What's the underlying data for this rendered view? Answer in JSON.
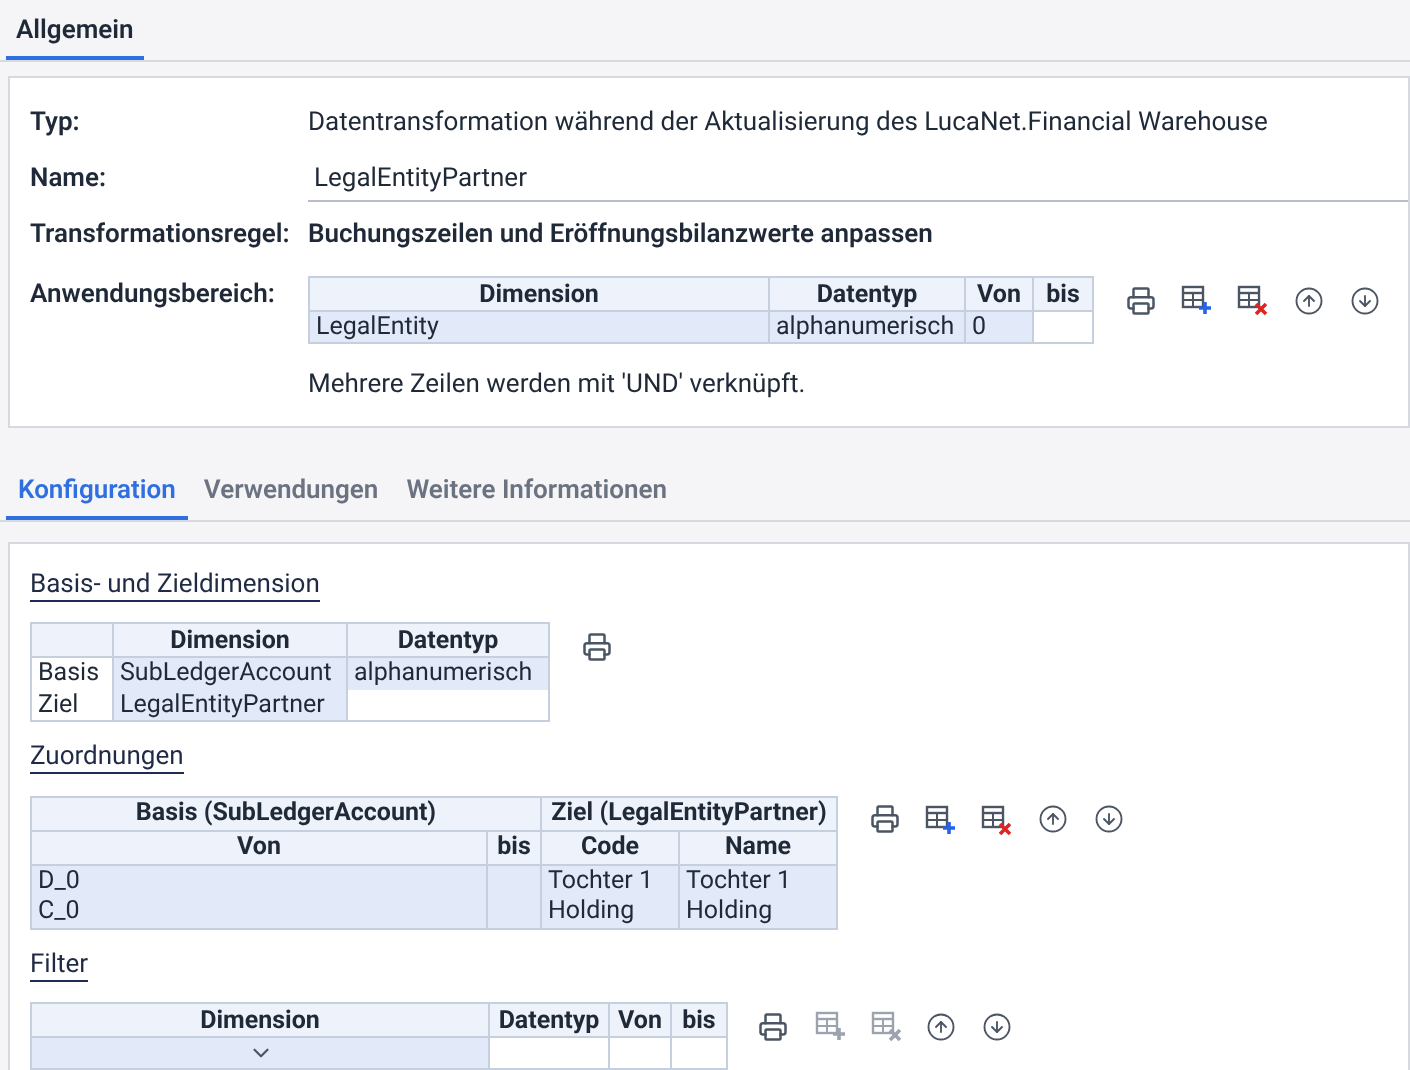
{
  "top_tabs": [
    {
      "label": "Allgemein",
      "selected": true
    }
  ],
  "general": {
    "fields": [
      {
        "kind": "text",
        "label": "Typ:",
        "value": "Datentransformation während der Aktualisierung des LucaNet.Financial Warehouse"
      },
      {
        "kind": "input",
        "label": "Name:",
        "value": "LegalEntityPartner"
      },
      {
        "kind": "bold",
        "label": "Transformationsregel:",
        "value": "Buchungszeilen und Eröffnungsbilanzwerte anpassen"
      }
    ],
    "scope": {
      "label": "Anwendungsbereich:",
      "table": {
        "groups": [
          {
            "columns": [
              "Dimension",
              "Datentyp",
              "Von",
              "bis"
            ]
          }
        ],
        "rows": [
          [
            {
              "text": "LegalEntity",
              "editable": true
            },
            {
              "text": "alphanumerisch",
              "editable": true
            },
            {
              "text": "0",
              "editable": true
            },
            {
              "editable": false
            }
          ]
        ]
      },
      "toolbar": [
        {
          "kind": "print",
          "disabled": false
        },
        {
          "kind": "add_row",
          "disabled": false
        },
        {
          "kind": "delete_row",
          "disabled": false
        },
        {
          "kind": "move_up",
          "disabled": false
        },
        {
          "kind": "move_down",
          "disabled": false
        }
      ],
      "note": "Mehrere Zeilen werden mit 'UND' verknüpft."
    }
  },
  "tabs": [
    {
      "label": "Konfiguration",
      "selected": true
    },
    {
      "label": "Verwendungen",
      "selected": false
    },
    {
      "label": "Weitere Informationen",
      "selected": false
    }
  ],
  "sections": [
    {
      "title": "Basis- und Zieldimension",
      "table": {
        "groups": [
          {
            "columns": [
              "",
              "Dimension",
              "Datentyp"
            ]
          }
        ],
        "rows": [
          [
            {
              "text": "Basis",
              "editable": false
            },
            {
              "text": "SubLedgerAccount",
              "editable": true
            },
            {
              "text": "alphanumerisch",
              "editable": true
            }
          ],
          [
            {
              "text": "Ziel",
              "editable": false
            },
            {
              "text": "LegalEntityPartner",
              "editable": true
            },
            {
              "editable": false
            }
          ]
        ]
      },
      "toolbar": [
        {
          "kind": "print",
          "disabled": false
        }
      ]
    },
    {
      "title": "Zuordnungen",
      "table": {
        "groups": [
          {
            "label": "Basis (SubLedgerAccount)",
            "columns": [
              "Von",
              "bis"
            ]
          },
          {
            "label": "Ziel (LegalEntityPartner)",
            "columns": [
              "Code",
              "Name"
            ]
          }
        ],
        "rows": [
          [
            {
              "text": "D_0",
              "editable": true
            },
            {
              "editable": true
            },
            {
              "text": "Tochter 1",
              "editable": true
            },
            {
              "text": "Tochter 1",
              "editable": true
            }
          ],
          [
            {
              "text": "C_0",
              "editable": true
            },
            {
              "editable": true
            },
            {
              "text": "Holding",
              "editable": true
            },
            {
              "text": "Holding",
              "editable": true
            }
          ]
        ]
      },
      "toolbar": [
        {
          "kind": "print",
          "disabled": false
        },
        {
          "kind": "add_row",
          "disabled": false
        },
        {
          "kind": "delete_row",
          "disabled": false
        },
        {
          "kind": "move_up",
          "disabled": false
        },
        {
          "kind": "move_down",
          "disabled": false
        }
      ]
    },
    {
      "title": "Filter",
      "table": {
        "groups": [
          {
            "columns": [
              "Dimension",
              "Datentyp",
              "Von",
              "bis"
            ]
          }
        ],
        "rows": [
          [
            {
              "kind": "dropdown",
              "editable": true
            },
            {
              "editable": false
            },
            {
              "editable": false
            },
            {
              "editable": false
            }
          ]
        ]
      },
      "toolbar": [
        {
          "kind": "print",
          "disabled": false
        },
        {
          "kind": "add_row",
          "disabled": true
        },
        {
          "kind": "delete_row",
          "disabled": true
        },
        {
          "kind": "move_up",
          "disabled": false
        },
        {
          "kind": "move_down",
          "disabled": false
        }
      ]
    }
  ]
}
